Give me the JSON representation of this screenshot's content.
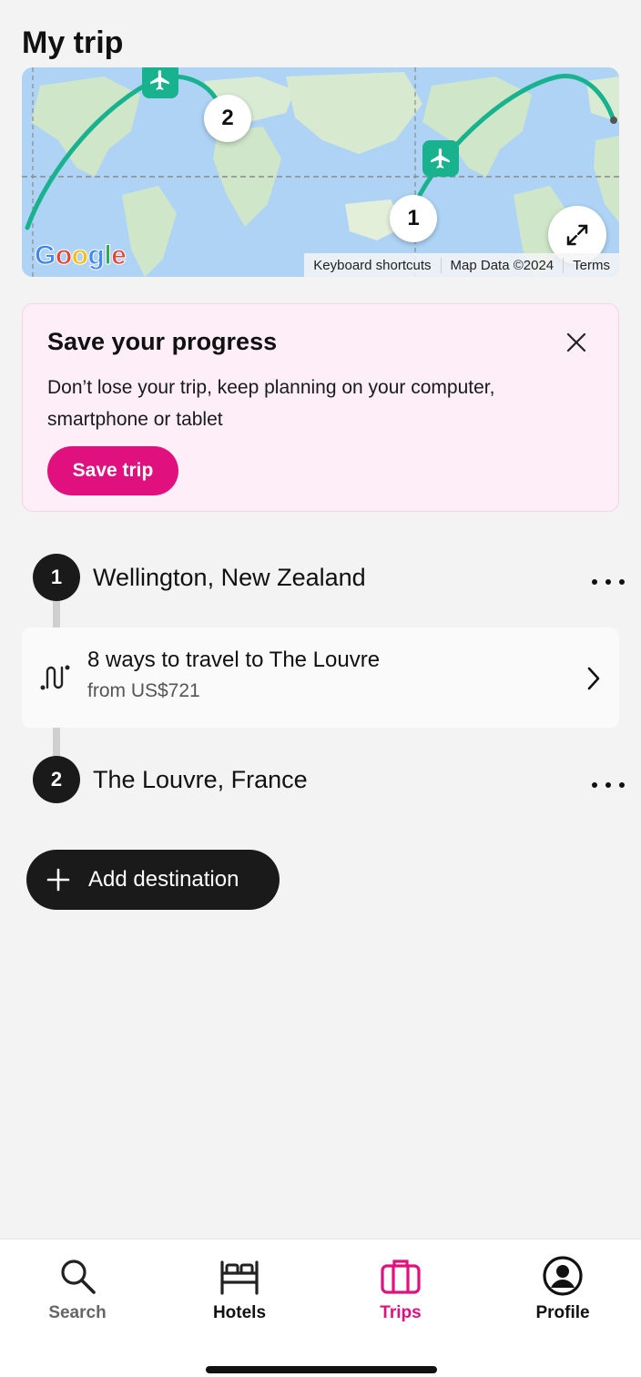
{
  "header": {
    "title": "My trip"
  },
  "map": {
    "attribution": [
      "Keyboard shortcuts",
      "Map Data ©2024",
      "Terms"
    ],
    "pins": [
      "1",
      "2"
    ],
    "route_color": "#18b38e",
    "logo": "Google"
  },
  "save_card": {
    "title": "Save your progress",
    "description": "Don’t lose your trip, keep planning on your computer, smartphone or tablet",
    "button_label": "Save trip",
    "accent_color": "#e0107e"
  },
  "itinerary": {
    "stops": [
      {
        "number": "1",
        "name": "Wellington, New Zealand"
      },
      {
        "number": "2",
        "name": "The Louvre, France"
      }
    ],
    "transport": {
      "title": "8 ways to travel to The Louvre",
      "price": "from US$721"
    }
  },
  "add_destination": {
    "label": "Add destination"
  },
  "tabbar": {
    "tabs": [
      {
        "label": "Search",
        "icon": "search-icon",
        "active": false
      },
      {
        "label": "Hotels",
        "icon": "bed-icon",
        "active": false
      },
      {
        "label": "Trips",
        "icon": "suitcase-icon",
        "active": true
      },
      {
        "label": "Profile",
        "icon": "profile-icon",
        "active": false
      }
    ],
    "active_color": "#e0107e"
  }
}
